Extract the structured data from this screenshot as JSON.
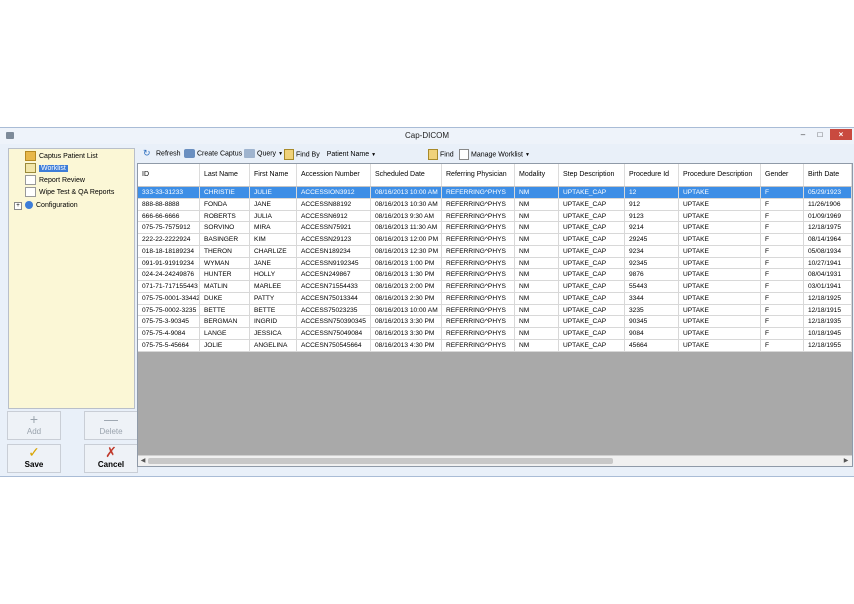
{
  "window": {
    "title": "Cap-DICOM"
  },
  "sidebar": {
    "items": [
      {
        "label": "Captus Patient List",
        "icon": "folder-icon"
      },
      {
        "label": "Worklist",
        "icon": "checklist-icon",
        "selected": true
      },
      {
        "label": "Report Review",
        "icon": "report-icon"
      },
      {
        "label": "Wipe Test & QA Reports",
        "icon": "report-icon"
      },
      {
        "label": "Configuration",
        "icon": "info-icon"
      }
    ],
    "buttons": {
      "add": "Add",
      "delete": "Delete",
      "save": "Save",
      "cancel": "Cancel"
    }
  },
  "toolbar": {
    "refresh": "Refresh",
    "create_captus": "Create Captus",
    "query": "Query",
    "find_by": "Find By",
    "find_by_value": "Patient Name",
    "find": "Find",
    "manage_worklist": "Manage Worklist"
  },
  "grid": {
    "columns": [
      "ID",
      "Last Name",
      "First Name",
      "Accession Number",
      "Scheduled Date",
      "Referring Physician",
      "Modality",
      "Step Description",
      "Procedure Id",
      "Procedure Description",
      "Gender",
      "Birth Date"
    ],
    "rows": [
      [
        "333-33-31233",
        "CHRISTIE",
        "JULIE",
        "ACCESSION3912",
        "08/16/2013 10:00 AM",
        "REFERRING^PHYS",
        "NM",
        "UPTAKE_CAP",
        "12",
        "UPTAKE",
        "F",
        "05/29/1923"
      ],
      [
        "888-88-8888",
        "FONDA",
        "JANE",
        "ACCESSN88192",
        "08/16/2013 10:30 AM",
        "REFERRING^PHYS",
        "NM",
        "UPTAKE_CAP",
        "912",
        "UPTAKE",
        "F",
        "11/26/1906"
      ],
      [
        "666-66-6666",
        "ROBERTS",
        "JULIA",
        "ACCESSN6912",
        "08/16/2013 9:30 AM",
        "REFERRING^PHYS",
        "NM",
        "UPTAKE_CAP",
        "9123",
        "UPTAKE",
        "F",
        "01/09/1969"
      ],
      [
        "075-75-7575912",
        "SORVINO",
        "MIRA",
        "ACCESSN75921",
        "08/16/2013 11:30 AM",
        "REFERRING^PHYS",
        "NM",
        "UPTAKE_CAP",
        "9214",
        "UPTAKE",
        "F",
        "12/18/1975"
      ],
      [
        "222-22-2222924",
        "BASINGER",
        "KIM",
        "ACCESSN29123",
        "08/16/2013 12:00 PM",
        "REFERRING^PHYS",
        "NM",
        "UPTAKE_CAP",
        "29245",
        "UPTAKE",
        "F",
        "08/14/1964"
      ],
      [
        "018-18-18189234",
        "THERON",
        "CHARLIZE",
        "ACCESN189234",
        "08/16/2013 12:30 PM",
        "REFERRING^PHYS",
        "NM",
        "UPTAKE_CAP",
        "9234",
        "UPTAKE",
        "F",
        "05/08/1934"
      ],
      [
        "091-91-91919234",
        "WYMAN",
        "JANE",
        "ACCESSN9192345",
        "08/16/2013 1:00 PM",
        "REFERRING^PHYS",
        "NM",
        "UPTAKE_CAP",
        "92345",
        "UPTAKE",
        "F",
        "10/27/1941"
      ],
      [
        "024-24-24249876",
        "HUNTER",
        "HOLLY",
        "ACCESN249867",
        "08/16/2013 1:30 PM",
        "REFERRING^PHYS",
        "NM",
        "UPTAKE_CAP",
        "9876",
        "UPTAKE",
        "F",
        "08/04/1931"
      ],
      [
        "071-71-717155443",
        "MATLIN",
        "MARLEE",
        "ACCESN71554433",
        "08/16/2013 2:00 PM",
        "REFERRING^PHYS",
        "NM",
        "UPTAKE_CAP",
        "55443",
        "UPTAKE",
        "F",
        "03/01/1941"
      ],
      [
        "075-75-0001-33442",
        "DUKE",
        "PATTY",
        "ACCESN75013344",
        "08/16/2013 2:30 PM",
        "REFERRING^PHYS",
        "NM",
        "UPTAKE_CAP",
        "3344",
        "UPTAKE",
        "F",
        "12/18/1925"
      ],
      [
        "075-75-0002-3235",
        "BETTE",
        "BETTE",
        "ACCESS75023235",
        "08/16/2013 10:00 AM",
        "REFERRING^PHYS",
        "NM",
        "UPTAKE_CAP",
        "3235",
        "UPTAKE",
        "F",
        "12/18/1915"
      ],
      [
        "075-75-3-90345",
        "BERGMAN",
        "INGRID",
        "ACCESSN750390345",
        "08/16/2013 3:30 PM",
        "REFERRING^PHYS",
        "NM",
        "UPTAKE_CAP",
        "90345",
        "UPTAKE",
        "F",
        "12/18/1935"
      ],
      [
        "075-75-4-9084",
        "LANGE",
        "JESSICA",
        "ACCESSN75049084",
        "08/16/2013 3:30 PM",
        "REFERRING^PHYS",
        "NM",
        "UPTAKE_CAP",
        "9084",
        "UPTAKE",
        "F",
        "10/18/1945"
      ],
      [
        "075-75-5-45664",
        "JOLIE",
        "ANGELINA",
        "ACCESN750545664",
        "08/16/2013 4:30 PM",
        "REFERRING^PHYS",
        "NM",
        "UPTAKE_CAP",
        "45664",
        "UPTAKE",
        "F",
        "12/18/1955"
      ]
    ],
    "selected_row": 0
  },
  "colors": {
    "selection": "#3d8ee6",
    "sidebar_bg": "#fbf7d6",
    "grid_empty": "#a9a9a9",
    "close_button": "#c94a3f"
  }
}
